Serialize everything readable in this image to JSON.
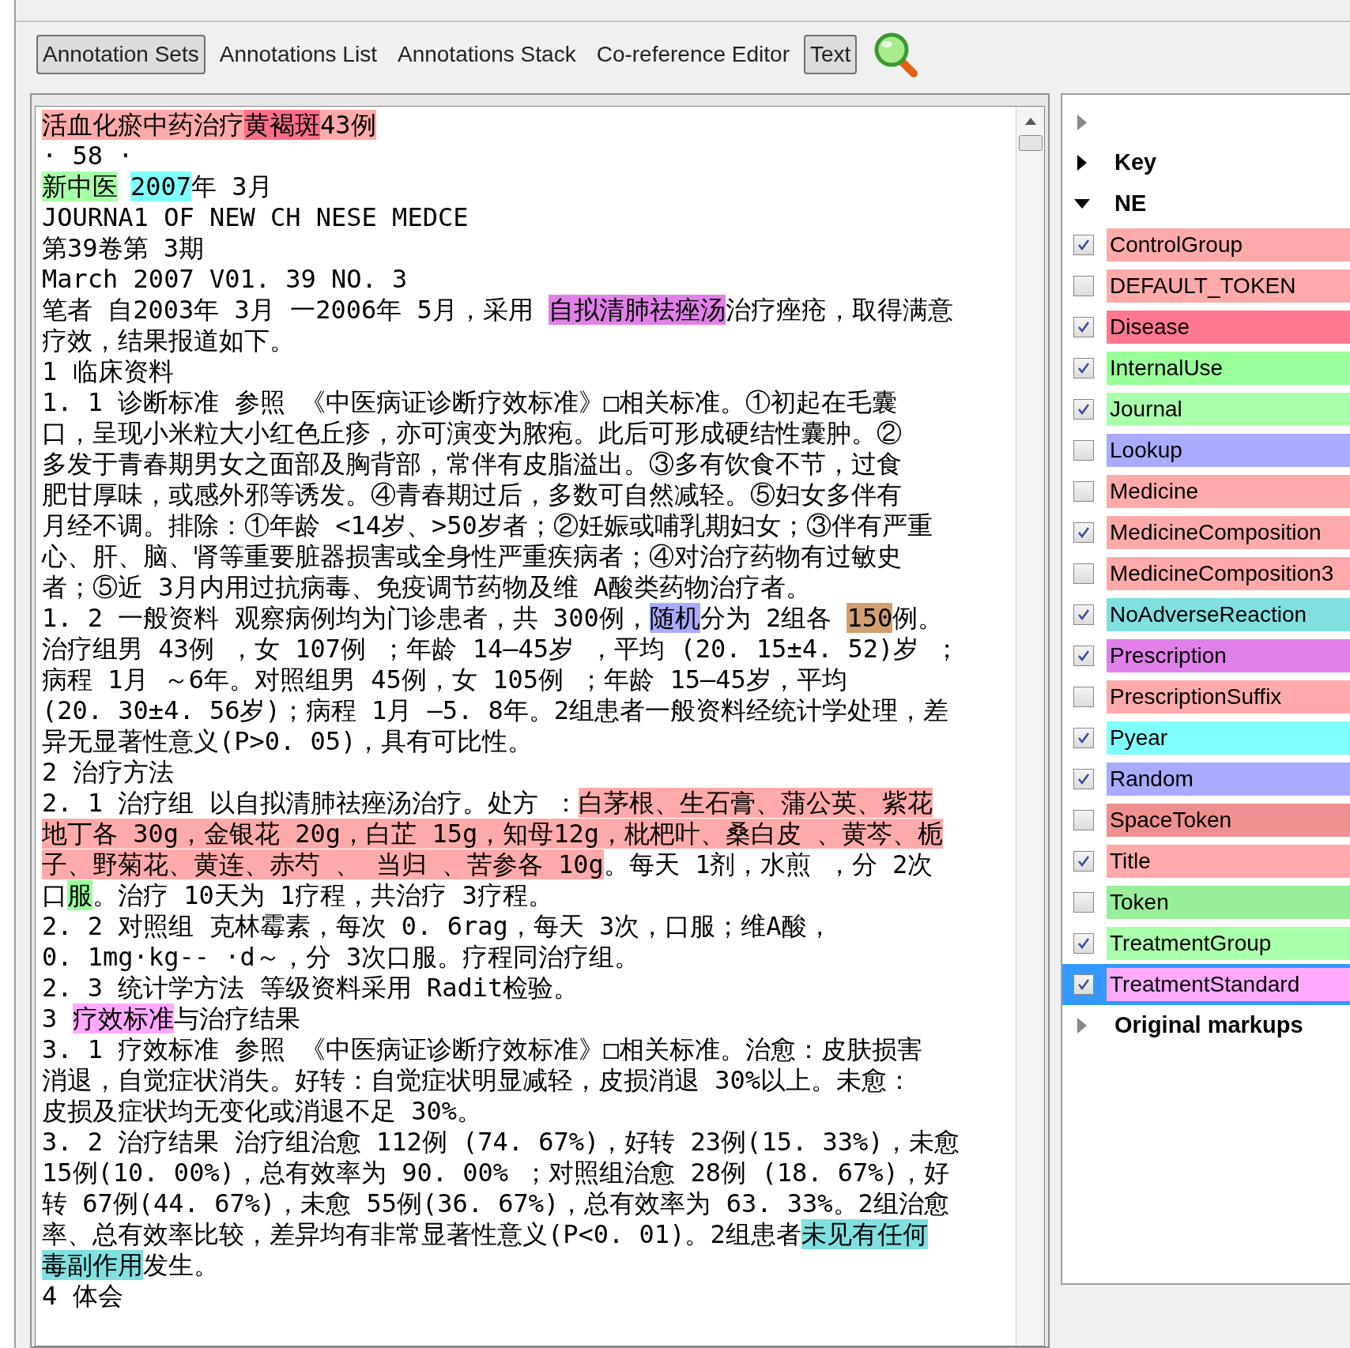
{
  "toolbar": {
    "tabs": [
      {
        "label": "Annotation Sets",
        "selected": true
      },
      {
        "label": "Annotations List",
        "selected": false
      },
      {
        "label": "Annotations Stack",
        "selected": false
      },
      {
        "label": "Co-reference Editor",
        "selected": false
      },
      {
        "label": "Text",
        "selected": true
      }
    ]
  },
  "document": {
    "lines": [
      [
        {
          "text": "活血化瘀中药治疗",
          "color": "#ffaaaa"
        },
        {
          "text": "黄褐斑",
          "color": "#ff6f8a"
        },
        {
          "text": "43例",
          "color": "#ffaaaa"
        }
      ],
      [
        {
          "text": "· 58 ·"
        }
      ],
      [
        {
          "text": "新中医",
          "color": "#aaffaa"
        },
        {
          "kind": "space"
        },
        {
          "text": "2007",
          "color": "#80ffff"
        },
        {
          "text": "年 3月"
        }
      ],
      [
        {
          "text": "JOURNA1 OF NEW CH NESE MEDCE"
        }
      ],
      [
        {
          "text": "第39卷第 3期"
        }
      ],
      [
        {
          "text": "March 2007 V01. 39 NO. 3"
        }
      ],
      [
        {
          "text": "笔者 自2003年 3月 一2006年 5月，采用 "
        },
        {
          "text": "自拟清肺祛痤汤",
          "color": "#e080e8"
        },
        {
          "text": "治疗痤疮，取得满意"
        }
      ],
      [
        {
          "text": "疗效，结果报道如下。"
        }
      ],
      [
        {
          "text": "1 临床资料"
        }
      ],
      [
        {
          "text": "1. 1 诊断标准 参照 《中医病证诊断疗效标准》□相关标准。①初起在毛囊"
        }
      ],
      [
        {
          "text": "口，呈现小米粒大小红色丘疹，亦可演变为脓疱。此后可形成硬结性囊肿。②"
        }
      ],
      [
        {
          "text": "多发于青春期男女之面部及胸背部，常伴有皮脂溢出。③多有饮食不节，过食"
        }
      ],
      [
        {
          "text": "肥甘厚味，或感外邪等诱发。④青春期过后，多数可自然减轻。⑤妇女多伴有"
        }
      ],
      [
        {
          "text": "月经不调。排除：①年龄 <14岁、>50岁者；②妊娠或哺乳期妇女；③伴有严重"
        }
      ],
      [
        {
          "text": "心、肝、脑、肾等重要脏器损害或全身性严重疾病者；④对治疗药物有过敏史"
        }
      ],
      [
        {
          "text": "者；⑤近 3月内用过抗病毒、免疫调节药物及维 A酸类药物治疗者。"
        }
      ],
      [
        {
          "text": "1. 2 一般资料 观察病例均为门诊患者，共 300例，"
        },
        {
          "text": "随机",
          "color": "#aaaaff"
        },
        {
          "text": "分为 2组各 "
        },
        {
          "text": "150",
          "color": "#d2a070"
        },
        {
          "text": "例。"
        }
      ],
      [
        {
          "text": "治疗组男 43例 ，女 107例 ；年龄 14—45岁 ，平均 (20. 15±4. 52)岁 ；"
        }
      ],
      [
        {
          "text": "病程 1月 ～6年。对照组男 45例，女 105例 ；年龄 15—45岁，平均"
        }
      ],
      [
        {
          "text": "(20. 30±4. 56岁)；病程 1月 —5. 8年。2组患者一般资料经统计学处理，差"
        }
      ],
      [
        {
          "text": "异无显著性意义(P>0. 05)，具有可比性。"
        }
      ],
      [
        {
          "text": "2 治疗方法"
        }
      ],
      [
        {
          "text": "2. 1 治疗组 以自拟清肺祛痤汤治疗。处方 ："
        },
        {
          "text": "白茅根、生石膏、蒲公英、紫花",
          "color": "#ffaaaa"
        }
      ],
      [
        {
          "text": "地丁各 30g，金银花 20g，白芷 15g，知母12g，枇杷叶、桑白皮 、黄芩、栀",
          "color": "#ffaaaa"
        }
      ],
      [
        {
          "text": "子、野菊花、黄连、赤芍 、 当归 、苦参各 10g",
          "color": "#ffaaaa"
        },
        {
          "text": "。每天 1剂，水煎 ，分 2次"
        }
      ],
      [
        {
          "text": "口"
        },
        {
          "text": "服",
          "color": "#99ff99"
        },
        {
          "text": "。治疗 10天为 1疗程，共治疗 3疗程。"
        }
      ],
      [
        {
          "text": "2. 2 对照组 克林霉素，每次 0. 6rag，每天 3次，口服；维A酸，"
        }
      ],
      [
        {
          "text": "0. 1mg·kg-- ·d～，分 3次口服。疗程同治疗组。"
        }
      ],
      [
        {
          "text": "2. 3 统计学方法 等级资料采用 Radit检验。"
        }
      ],
      [
        {
          "text": "3 "
        },
        {
          "text": "疗效标准",
          "color": "#ffaaff"
        },
        {
          "text": "与治疗结果"
        }
      ],
      [
        {
          "text": "3. 1 疗效标准 参照 《中医病证诊断疗效标准》□相关标准。治愈：皮肤损害"
        }
      ],
      [
        {
          "text": "消退，自觉症状消失。好转：自觉症状明显减轻，皮损消退 30%以上。未愈："
        }
      ],
      [
        {
          "text": "皮损及症状均无变化或消退不足 30%。"
        }
      ],
      [
        {
          "text": "3. 2 治疗结果 治疗组治愈 112例 (74. 67%)，好转 23例(15. 33%)，未愈"
        }
      ],
      [
        {
          "text": "15例(10. 00%)，总有效率为 90. 00% ；对照组治愈 28例 (18. 67%)，好"
        }
      ],
      [
        {
          "text": "转 67例(44. 67%)，未愈 55例(36. 67%)，总有效率为 63. 33%。2组治愈"
        }
      ],
      [
        {
          "text": "率、总有效率比较，差异均有非常显著性意义(P<0. 01)。2组患者"
        },
        {
          "text": "未见有任何",
          "color": "#80e0e0"
        }
      ],
      [
        {
          "text": "毒副作用",
          "color": "#80e0e0"
        },
        {
          "text": "发生。"
        }
      ],
      [
        {
          "text": "4 体会"
        }
      ]
    ]
  },
  "annotation_tree": {
    "nodes": [
      {
        "label": "Key",
        "expanded": false
      },
      {
        "label": "NE",
        "expanded": true,
        "children": [
          {
            "label": "ControlGroup",
            "checked": true,
            "color": "#ffaaaa",
            "selected": false
          },
          {
            "label": "DEFAULT_TOKEN",
            "checked": false,
            "color": "#ffaaaa",
            "selected": false
          },
          {
            "label": "Disease",
            "checked": true,
            "color": "#ff7890",
            "selected": false
          },
          {
            "label": "InternalUse",
            "checked": true,
            "color": "#99ff99",
            "selected": false
          },
          {
            "label": "Journal",
            "checked": true,
            "color": "#aaffaa",
            "selected": false
          },
          {
            "label": "Lookup",
            "checked": false,
            "color": "#aaaaff",
            "selected": false
          },
          {
            "label": "Medicine",
            "checked": false,
            "color": "#ffaaaa",
            "selected": false
          },
          {
            "label": "MedicineComposition",
            "checked": true,
            "color": "#ffaaaa",
            "selected": false
          },
          {
            "label": "MedicineComposition3",
            "checked": false,
            "color": "#ffaaaa",
            "selected": false
          },
          {
            "label": "NoAdverseReaction",
            "checked": true,
            "color": "#80e0e0",
            "selected": false
          },
          {
            "label": "Prescription",
            "checked": true,
            "color": "#e080e8",
            "selected": false
          },
          {
            "label": "PrescriptionSuffix",
            "checked": false,
            "color": "#ffaaaa",
            "selected": false
          },
          {
            "label": "Pyear",
            "checked": true,
            "color": "#80ffff",
            "selected": false
          },
          {
            "label": "Random",
            "checked": true,
            "color": "#aaaaff",
            "selected": false
          },
          {
            "label": "SpaceToken",
            "checked": false,
            "color": "#ee9090",
            "selected": false
          },
          {
            "label": "Title",
            "checked": true,
            "color": "#ffaaaa",
            "selected": false
          },
          {
            "label": "Token",
            "checked": false,
            "color": "#99ee99",
            "selected": false
          },
          {
            "label": "TreatmentGroup",
            "checked": true,
            "color": "#aaffaa",
            "selected": false
          },
          {
            "label": "TreatmentStandard",
            "checked": true,
            "color": "#ffaaff",
            "selected": true
          }
        ]
      },
      {
        "label": "Original markups",
        "expanded": false
      }
    ]
  }
}
